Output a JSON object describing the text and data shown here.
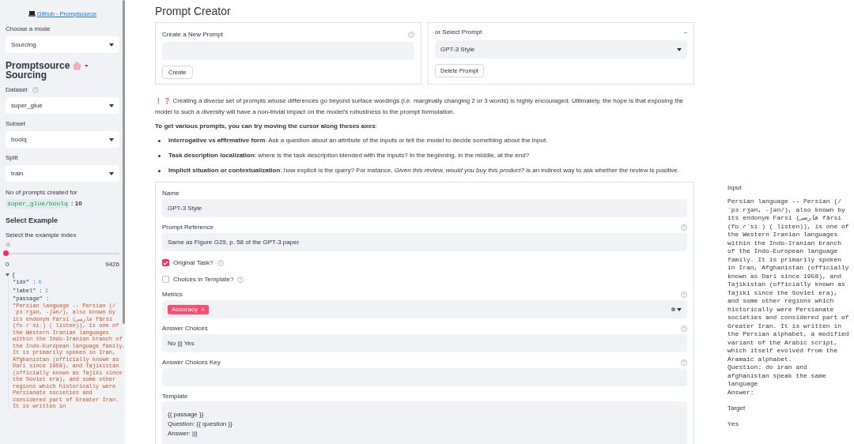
{
  "sidebar": {
    "github_link": "Github - Promptsource",
    "mode": {
      "label": "Choose a mode",
      "value": "Sourcing"
    },
    "title": "Promptsource",
    "title_suffix": "- Sourcing",
    "selects": [
      {
        "label": "Dataset",
        "help": true,
        "value": "super_glue"
      },
      {
        "label": "Subset",
        "help": false,
        "value": "boolq"
      },
      {
        "label": "Split",
        "help": false,
        "value": "train"
      }
    ],
    "prompt_count": {
      "label": "No of prompts created for",
      "dataset": "super_glue/boolq",
      "separator": ":",
      "count": "10"
    },
    "example_heading": "Select Example",
    "slider": {
      "label": "Select the example index",
      "value": "0",
      "min": "0",
      "max": "9426",
      "level": 0
    },
    "example": {
      "open_brace": "{",
      "entries": [
        {
          "key": "\"idx\"",
          "sep": ":",
          "value": "0",
          "kind": "number"
        },
        {
          "key": "\"label\"",
          "sep": ":",
          "value": "1",
          "kind": "number"
        },
        {
          "key": "\"passage\"",
          "sep": ":",
          "value": "\"Persian language -- Persian (/ˈpɜːrʒən, -ʃən/), also known by its endonym Farsi (فارسی fārsi (fɒːɾˈsiː) ( listen)), is one of the Western Iranian languages within the Indo-Iranian branch of the Indo-European language family. It is primarily spoken in Iran, Afghanistan (officially known as Dari since 1958), and Tajikistan (officially known as Tajiki since the Soviet era), and some other regions which historically were Persianate societies and considered part of Greater Iran. It is written in",
          "kind": "string"
        }
      ]
    }
  },
  "main": {
    "title": "Prompt Creator",
    "create": {
      "label": "Create a New Prompt",
      "button": "Create"
    },
    "select": {
      "label": "or Select Prompt",
      "collapse": "–",
      "value": "GPT-3 Style",
      "button": "Delete Prompt"
    },
    "marks": "❗ ❓",
    "intro": "Creating a diverse set of prompts whose differences go beyond surface wordings (i.e. marginally changing 2 or 3 words) is highly encouraged. Ultimately, the hope is that exposing the model to such a diversity will have a non-trivial impact on the model's robustness to the prompt formulation.",
    "axes_heading": "To get various prompts, you can try moving the cursor along theses axes",
    "axes_colon": ":",
    "axes": [
      "**Interrogative vs affirmative form**: Ask a question about an attribute of the inputs or tell the model to decide something about the input.",
      "**Task description localization**: where is the task description blended with the inputs? In the beginning, in the middle, at the end?",
      "**Implicit situation or contextualization**: how explicit is the query? For instance, *Given this review, would you buy this product?* is an indirect way to ask whether the review is positive."
    ],
    "form": [
      {
        "kind": "text",
        "label": "Name",
        "help": false,
        "value": "GPT-3 Style"
      },
      {
        "kind": "text",
        "label": "Prompt Reference",
        "help": true,
        "value": "Same as Figure G29, p. 58 of the GPT-3 paper"
      },
      {
        "kind": "checkbox",
        "label": "Original Task?",
        "checked": true
      },
      {
        "kind": "checkbox",
        "label": "Choices in Template?",
        "checked": false
      },
      {
        "kind": "multiselect",
        "label": "Metrics",
        "help": true,
        "tags": [
          "Accuracy"
        ]
      },
      {
        "kind": "text",
        "label": "Answer Choices",
        "help": true,
        "value": "No ||| Yes"
      },
      {
        "kind": "text",
        "label": "Answer Choices Key",
        "help": true
      },
      {
        "kind": "textarea",
        "label": "Template",
        "help": false,
        "value": "{{ passage }}\nQuestion: {{ question }}\nAnswer: |||"
      }
    ]
  },
  "preview": {
    "input_heading": "Input",
    "input": "Persian language -- Persian (/ˈpɜːrʒən, -ʃən/), also known by its endonym Farsi (فارسی fārsi (fɒːɾˈsiː) ( listen)), is one of the Western Iranian languages within the Indo-Iranian branch of the Indo-European language family. It is primarily spoken in Iran, Afghanistan (officially known as Dari since 1958), and Tajikistan (officially known as Tajiki since the Soviet era), and some other regions which historically were Persianate societies and considered part of Greater Iran. It is written in the Persian alphabet, a modified variant of the Arabic script, which itself evolved from the Aramaic alphabet.\nQuestion: do iran and afghanistan speak the same language\nAnswer:",
    "target_heading": "Target",
    "target": "Yes"
  }
}
